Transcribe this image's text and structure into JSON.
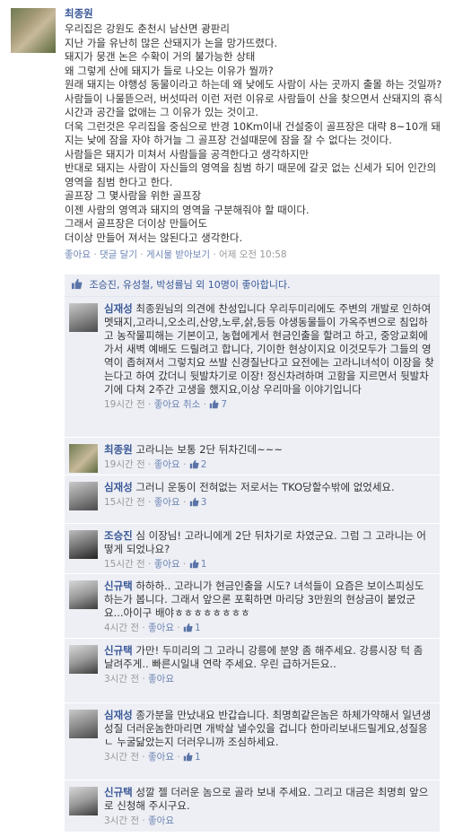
{
  "post": {
    "author": "최종원",
    "lines": [
      "우리집은 강원도 춘천시 남산면 광판리",
      "지난 가을 유난히 많은 산돼지가 논을 망가뜨렸다.",
      "돼지가 뭉갠 논은 수확이 거의 불가능한 상태",
      "왜 그렇게 산에 돼지가 들로 나오는 이유가 뭘까?",
      "원래 돼지는 야행성 동물이라고 하는데 왜 낮에도 사람이 사는 곳까지 출몰 하는 것일까?",
      "사람들이 나물뜯으러, 버섯따러 이런 저런 이유로 사람들이 산을 찾으면서 산돼지의 휴식 시간과 공간을 없애는 그 이유가 있는 것이고.",
      "더욱 그런것은 우리집을 중심으로 반경 10Km이내 건설중이 골프장은 대략 8~10개 돼지는 낮에 잠을 자야 하거늘 그 골프장 건설때문에 잠을 잘 수 없다는 것이다.",
      "사람들은 돼지가 미쳐서 사람들을 공격한다고 생각하지만",
      "반대로 돼지는 사람이 자신들의 영역을 침범 하기 때문에 갈곳 없는 신세가 되어 인간의 영역을 침범 한다고 한다.",
      "골프장 그 몇사람을 위한 골프장",
      "이젠 사람의 영역과 돼지의 영역을 구분해줘야 할 때이다.",
      "그래서 골프장은 더이상 만들어도",
      "더이상 만들어 져서는 않된다고 생각한다."
    ],
    "actions": {
      "like": "좋아요",
      "comment": "댓글 달기",
      "share": "게시물 받아보기",
      "time": "어제 오전 10:58"
    }
  },
  "likes": {
    "text": "조승진, 유성철, 박성률님 외 10명이 좋아합니다."
  },
  "comments": [
    {
      "author": "심재성",
      "text": "최종원님의 의견에 찬성입니다 우리두미리에도 주변의 개발로 인하여 멧돼지,고라니,오소리,산양,노루,삵,등등 야생동물들이 가옥주변으로 침입하고 농작물피해는 기본이고, 농협에게서 현금인출을 할려고 하고, 중앙교회에 가서 새벽 예배도 드릴려고 합니다, 기이한 현상이지요 이것모두가 그들의 영역이 좁혀져서 그렇치요 쓰발 신경질난다고 요전에는 고라니녀석이 이장을 찾는다고 하여 갔더니 뒷발차기로 이장! 정신차려하며 고함을 지르면서 뒷발차기에 다쳐 2주간 고생을 했지요,이상 우리마을 이야기입니다",
      "time": "19시간 전",
      "like": "좋아요 취소",
      "count": "7"
    },
    {
      "author": "최종원",
      "text": "고라니는 보통 2단 뒤차긴데~~~",
      "time": "19시간 전",
      "like": "좋아요",
      "count": "2"
    },
    {
      "author": "심재성",
      "text": "그러니 운동이 전혀없는 저로서는 TKO당할수밖에 없었세요.",
      "time": "15시간 전",
      "like": "좋아요",
      "count": "3"
    },
    {
      "author": "조승진",
      "text": "심 이장님! 고라니에게 2단 뒤차기로 차였군요. 그럼 그 고라니는 어떻게 되었나요?",
      "time": "15시간 전",
      "like": "좋아요",
      "count": "1"
    },
    {
      "author": "신규택",
      "text": "하하하.. 고라니가 현금인출을 시도? 녀석들이 요즘은 보이스피싱도 하는가 봅니다. 그래서 앞으론 포획하면 마리당 3만원의 현상금이 붙었군요...아이구 배야ㅎㅎㅎㅎㅎㅎㅎㅎ",
      "time": "4시간 전",
      "like": "좋아요",
      "count": "1"
    },
    {
      "author": "신규택",
      "text": "가만! 두미리의 그 고라니 강릉에 분양 좀 해주세요. 강릉시장 턱 좀 날려주게.. 빠른시일내 연락 주세요. 우린 급하거든요..",
      "time": "3시간 전",
      "like": "좋아요",
      "count": ""
    },
    {
      "author": "심재성",
      "text": "종가분을 만났내요 반갑습니다. 최명희같은놈은 하체가약해서 일년생 성질 더러운놈한마리면 개박살 낼수있을 겁니다 한마리보내드릴게요,성질응ㄴ 누굴닮았는지 더러우니까 조심하세요.",
      "time": "3시간 전",
      "like": "좋아요",
      "count": "1"
    },
    {
      "author": "신규택",
      "text": "성깔 젤 더러운 놈으로 골라 보내 주세요. 그리고 대금은 최명희 앞으로 신청해 주시구요.",
      "time": "3시간 전",
      "like": "좋아요",
      "count": ""
    }
  ]
}
